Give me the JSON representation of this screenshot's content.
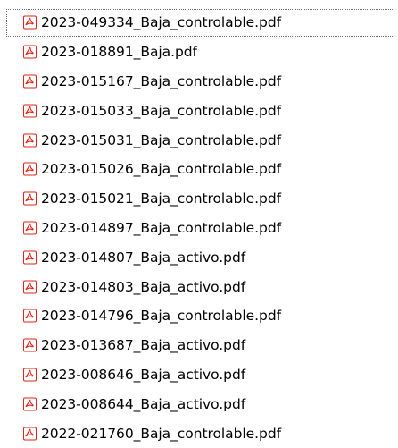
{
  "file_explorer": {
    "accent_color": "#e2231a",
    "icon_name": "pdf-icon",
    "files": [
      "2023-049334_Baja_controlable.pdf",
      "2023-018891_Baja.pdf",
      "2023-015167_Baja_controlable.pdf",
      "2023-015033_Baja_controlable.pdf",
      "2023-015031_Baja_controlable.pdf",
      "2023-015026_Baja_controlable.pdf",
      "2023-015021_Baja_controlable.pdf",
      "2023-014897_Baja_controlable.pdf",
      "2023-014807_Baja_activo.pdf",
      "2023-014803_Baja_activo.pdf",
      "2023-014796_Baja_controlable.pdf",
      "2023-013687_Baja_activo.pdf",
      "2023-008646_Baja_activo.pdf",
      "2023-008644_Baja_activo.pdf",
      "2022-021760_Baja_controlable.pdf"
    ]
  }
}
